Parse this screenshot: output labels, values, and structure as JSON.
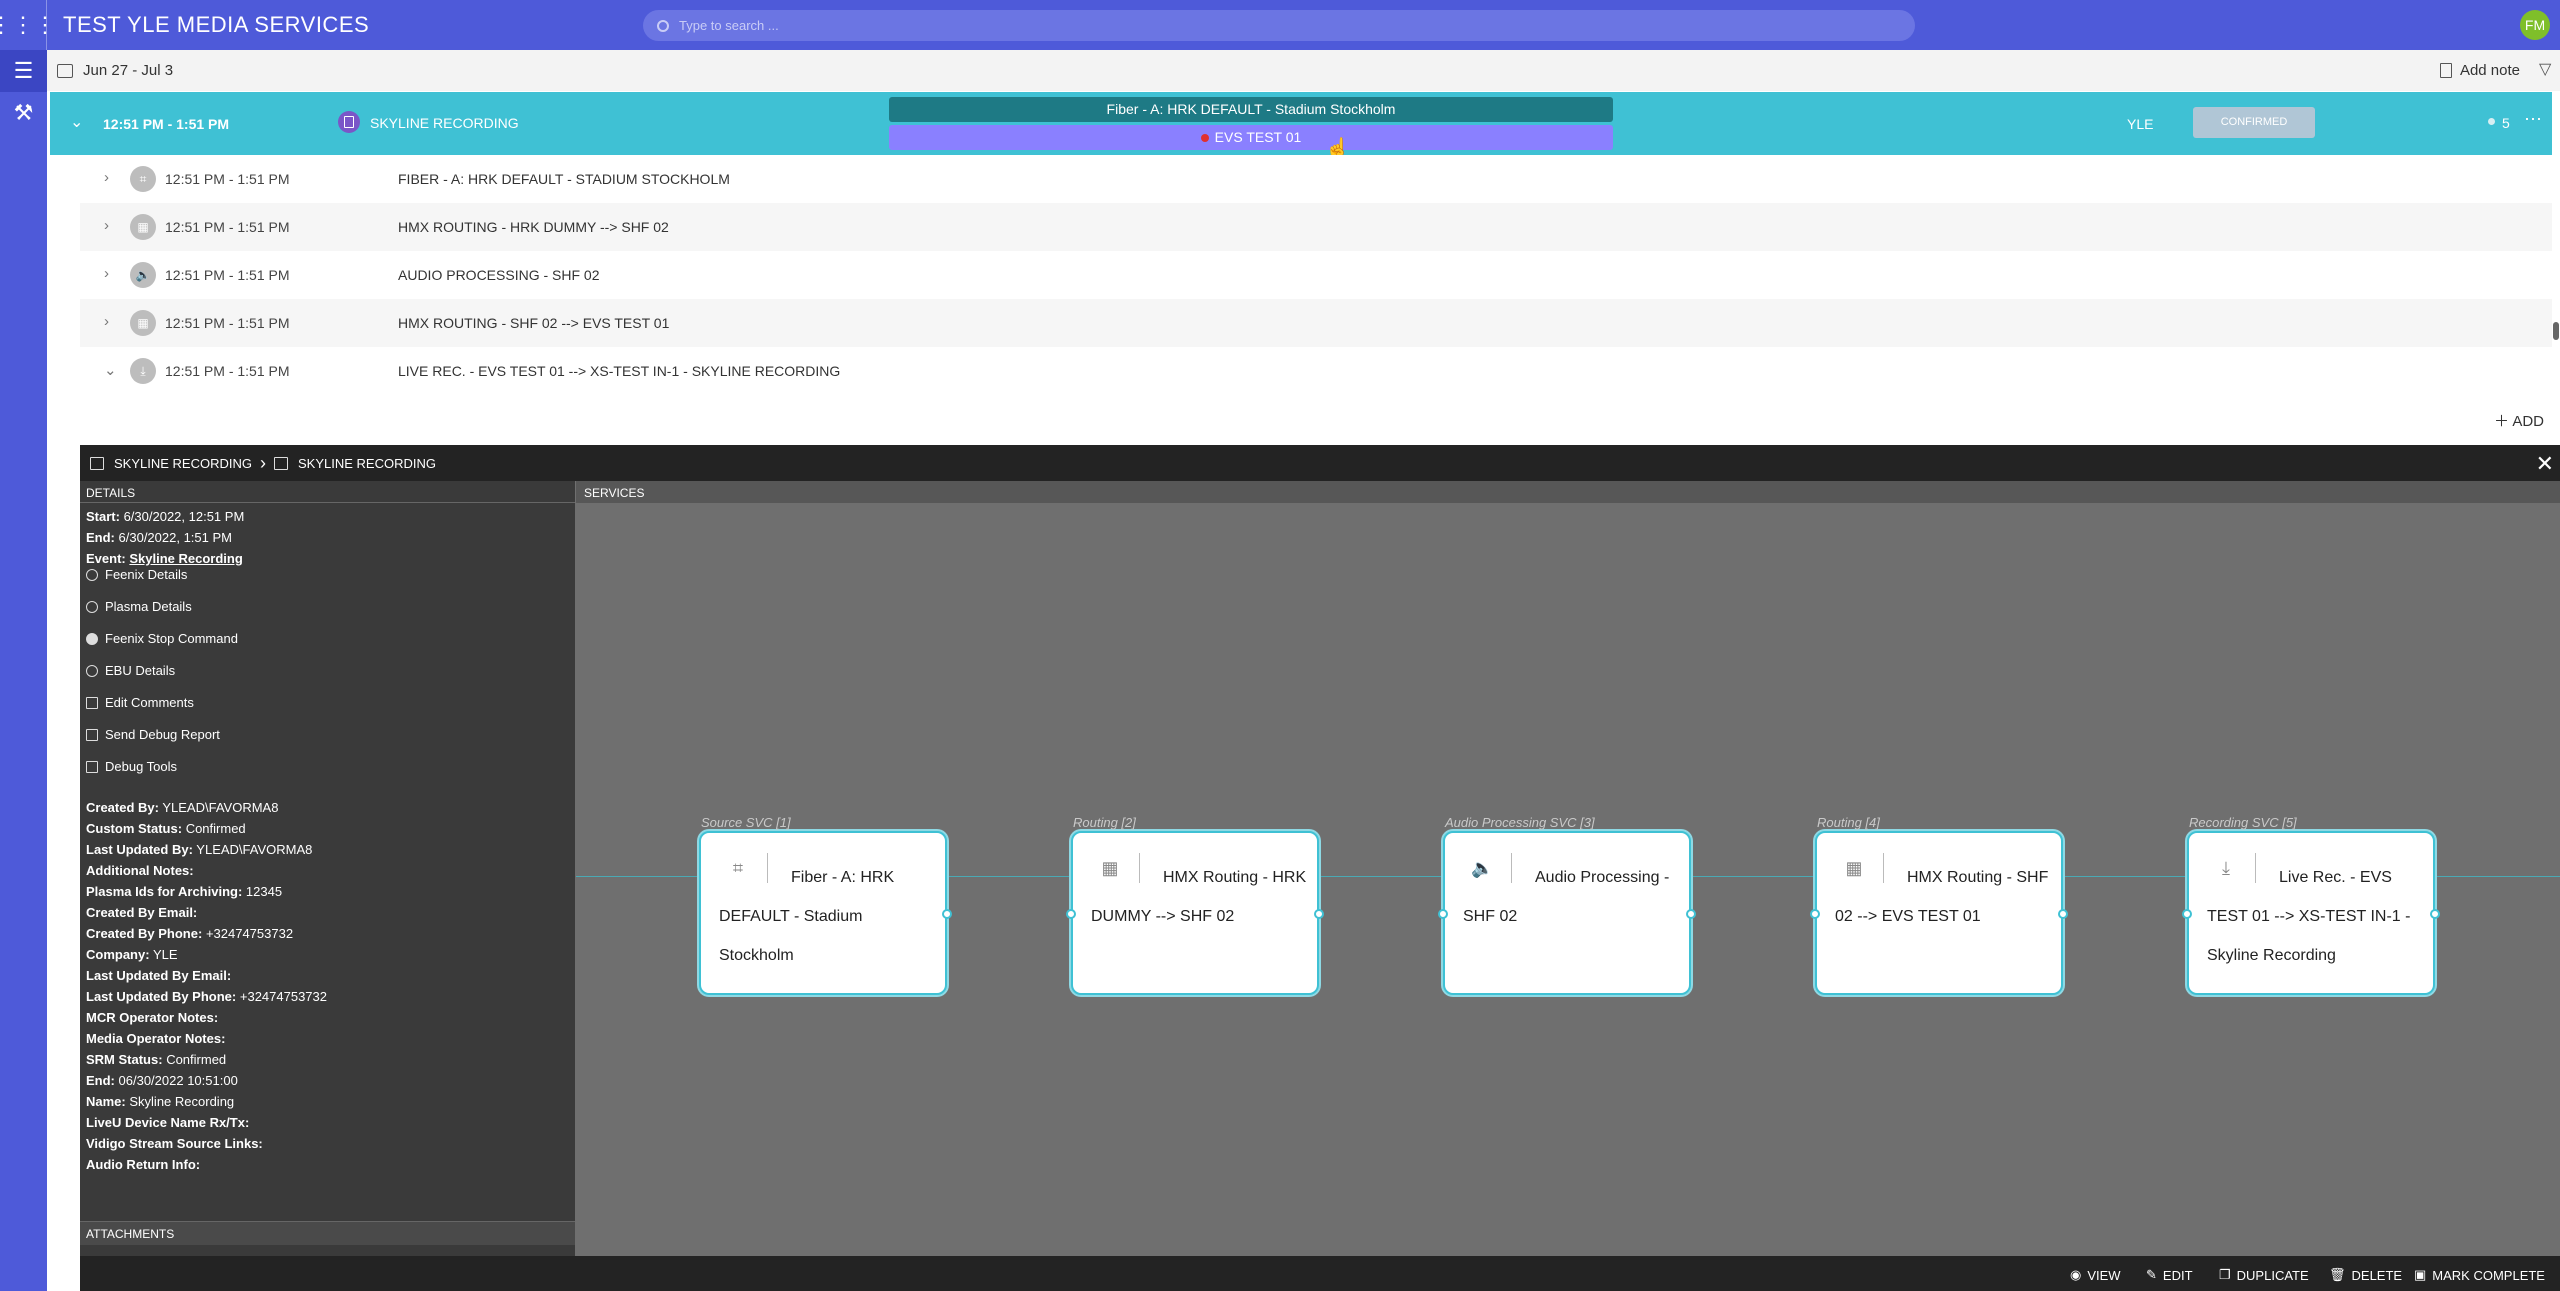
{
  "app": {
    "title": "TEST YLE MEDIA SERVICES",
    "search_placeholder": "Type to search ...",
    "user_initials": "FM"
  },
  "subbar": {
    "date_range": "Jun 27 - Jul 3",
    "add_note": "Add note"
  },
  "order": {
    "time": "12:51 PM - 1:51 PM",
    "name": "SKYLINE RECORDING",
    "timeline_top": "Fiber - A: HRK DEFAULT - Stadium Stockholm",
    "timeline_bottom": "EVS TEST 01",
    "company": "YLE",
    "status": "CONFIRMED",
    "count": "5"
  },
  "service_rows": [
    {
      "time": "12:51 PM - 1:51 PM",
      "name": "FIBER - A: HRK DEFAULT - STADIUM STOCKHOLM",
      "icon": "fiber-icon"
    },
    {
      "time": "12:51 PM - 1:51 PM",
      "name": "HMX ROUTING - HRK DUMMY --> SHF 02",
      "icon": "routing-icon"
    },
    {
      "time": "12:51 PM - 1:51 PM",
      "name": "AUDIO PROCESSING - SHF 02",
      "icon": "speaker-icon"
    },
    {
      "time": "12:51 PM - 1:51 PM",
      "name": "HMX ROUTING - SHF 02 --> EVS TEST 01",
      "icon": "routing-icon"
    },
    {
      "time": "12:51 PM - 1:51 PM",
      "name": "LIVE REC. - EVS TEST 01 --> XS-TEST IN-1 - SKYLINE RECORDING",
      "icon": "download-icon"
    }
  ],
  "add_label": "ADD",
  "panel": {
    "crumb1": "SKYLINE RECORDING",
    "crumb2": "SKYLINE RECORDING",
    "details_title": "DETAILS",
    "services_title": "SERVICES",
    "attachments_title": "ATTACHMENTS",
    "start_label": "Start:",
    "start_value": "6/30/2022, 12:51 PM",
    "end_label": "End:",
    "end_value": "6/30/2022, 1:51 PM",
    "event_label": "Event:",
    "event_value": "Skyline Recording",
    "actions": [
      "Feenix Details",
      "Plasma Details",
      "Feenix Stop Command",
      "EBU Details",
      "Edit Comments",
      "Send Debug Report",
      "Debug Tools"
    ],
    "fields": [
      {
        "label": "Created By:",
        "value": "YLEAD\\FAVORMA8"
      },
      {
        "label": "Custom Status:",
        "value": "Confirmed"
      },
      {
        "label": "Last Updated By:",
        "value": "YLEAD\\FAVORMA8"
      },
      {
        "label": "Additional Notes:",
        "value": ""
      },
      {
        "label": "Plasma Ids for Archiving:",
        "value": "12345"
      },
      {
        "label": "Created By Email:",
        "value": ""
      },
      {
        "label": "Created By Phone:",
        "value": "+32474753732"
      },
      {
        "label": "Company:",
        "value": "YLE"
      },
      {
        "label": "Last Updated By Email:",
        "value": ""
      },
      {
        "label": "Last Updated By Phone:",
        "value": "+32474753732"
      },
      {
        "label": "MCR Operator Notes:",
        "value": ""
      },
      {
        "label": "Media Operator Notes:",
        "value": ""
      },
      {
        "label": "SRM Status:",
        "value": "Confirmed"
      },
      {
        "label": "End:",
        "value": "06/30/2022 10:51:00"
      },
      {
        "label": "Name:",
        "value": "Skyline Recording"
      },
      {
        "label": "LiveU Device Name Rx/Tx:",
        "value": ""
      },
      {
        "label": "Vidigo Stream Source Links:",
        "value": ""
      },
      {
        "label": "Audio Return Info:",
        "value": ""
      }
    ],
    "nodes": [
      {
        "type": "Source SVC [1]",
        "text": "Fiber - A: HRK DEFAULT - Stadium Stockholm",
        "icon": "fiber-icon"
      },
      {
        "type": "Routing [2]",
        "text": "HMX Routing - HRK DUMMY --> SHF 02",
        "icon": "routing-icon"
      },
      {
        "type": "Audio Processing SVC [3]",
        "text": "Audio Processing - SHF 02",
        "icon": "speaker-icon"
      },
      {
        "type": "Routing [4]",
        "text": "HMX Routing - SHF 02 --> EVS TEST 01",
        "icon": "routing-icon"
      },
      {
        "type": "Recording SVC [5]",
        "text": "Live Rec. - EVS TEST 01 --> XS-TEST IN-1 - Skyline Recording",
        "icon": "download-icon"
      }
    ],
    "footer": {
      "view": "VIEW",
      "edit": "EDIT",
      "duplicate": "DUPLICATE",
      "delete": "DELETE",
      "mark_complete": "MARK COMPLETE"
    }
  },
  "colors": {
    "brand": "#4e5ad9",
    "accent": "#3fc1d4",
    "timeline_dark": "#1e7a85",
    "timeline_light": "#8a80ff",
    "panel_bg": "#6f6f6f"
  }
}
